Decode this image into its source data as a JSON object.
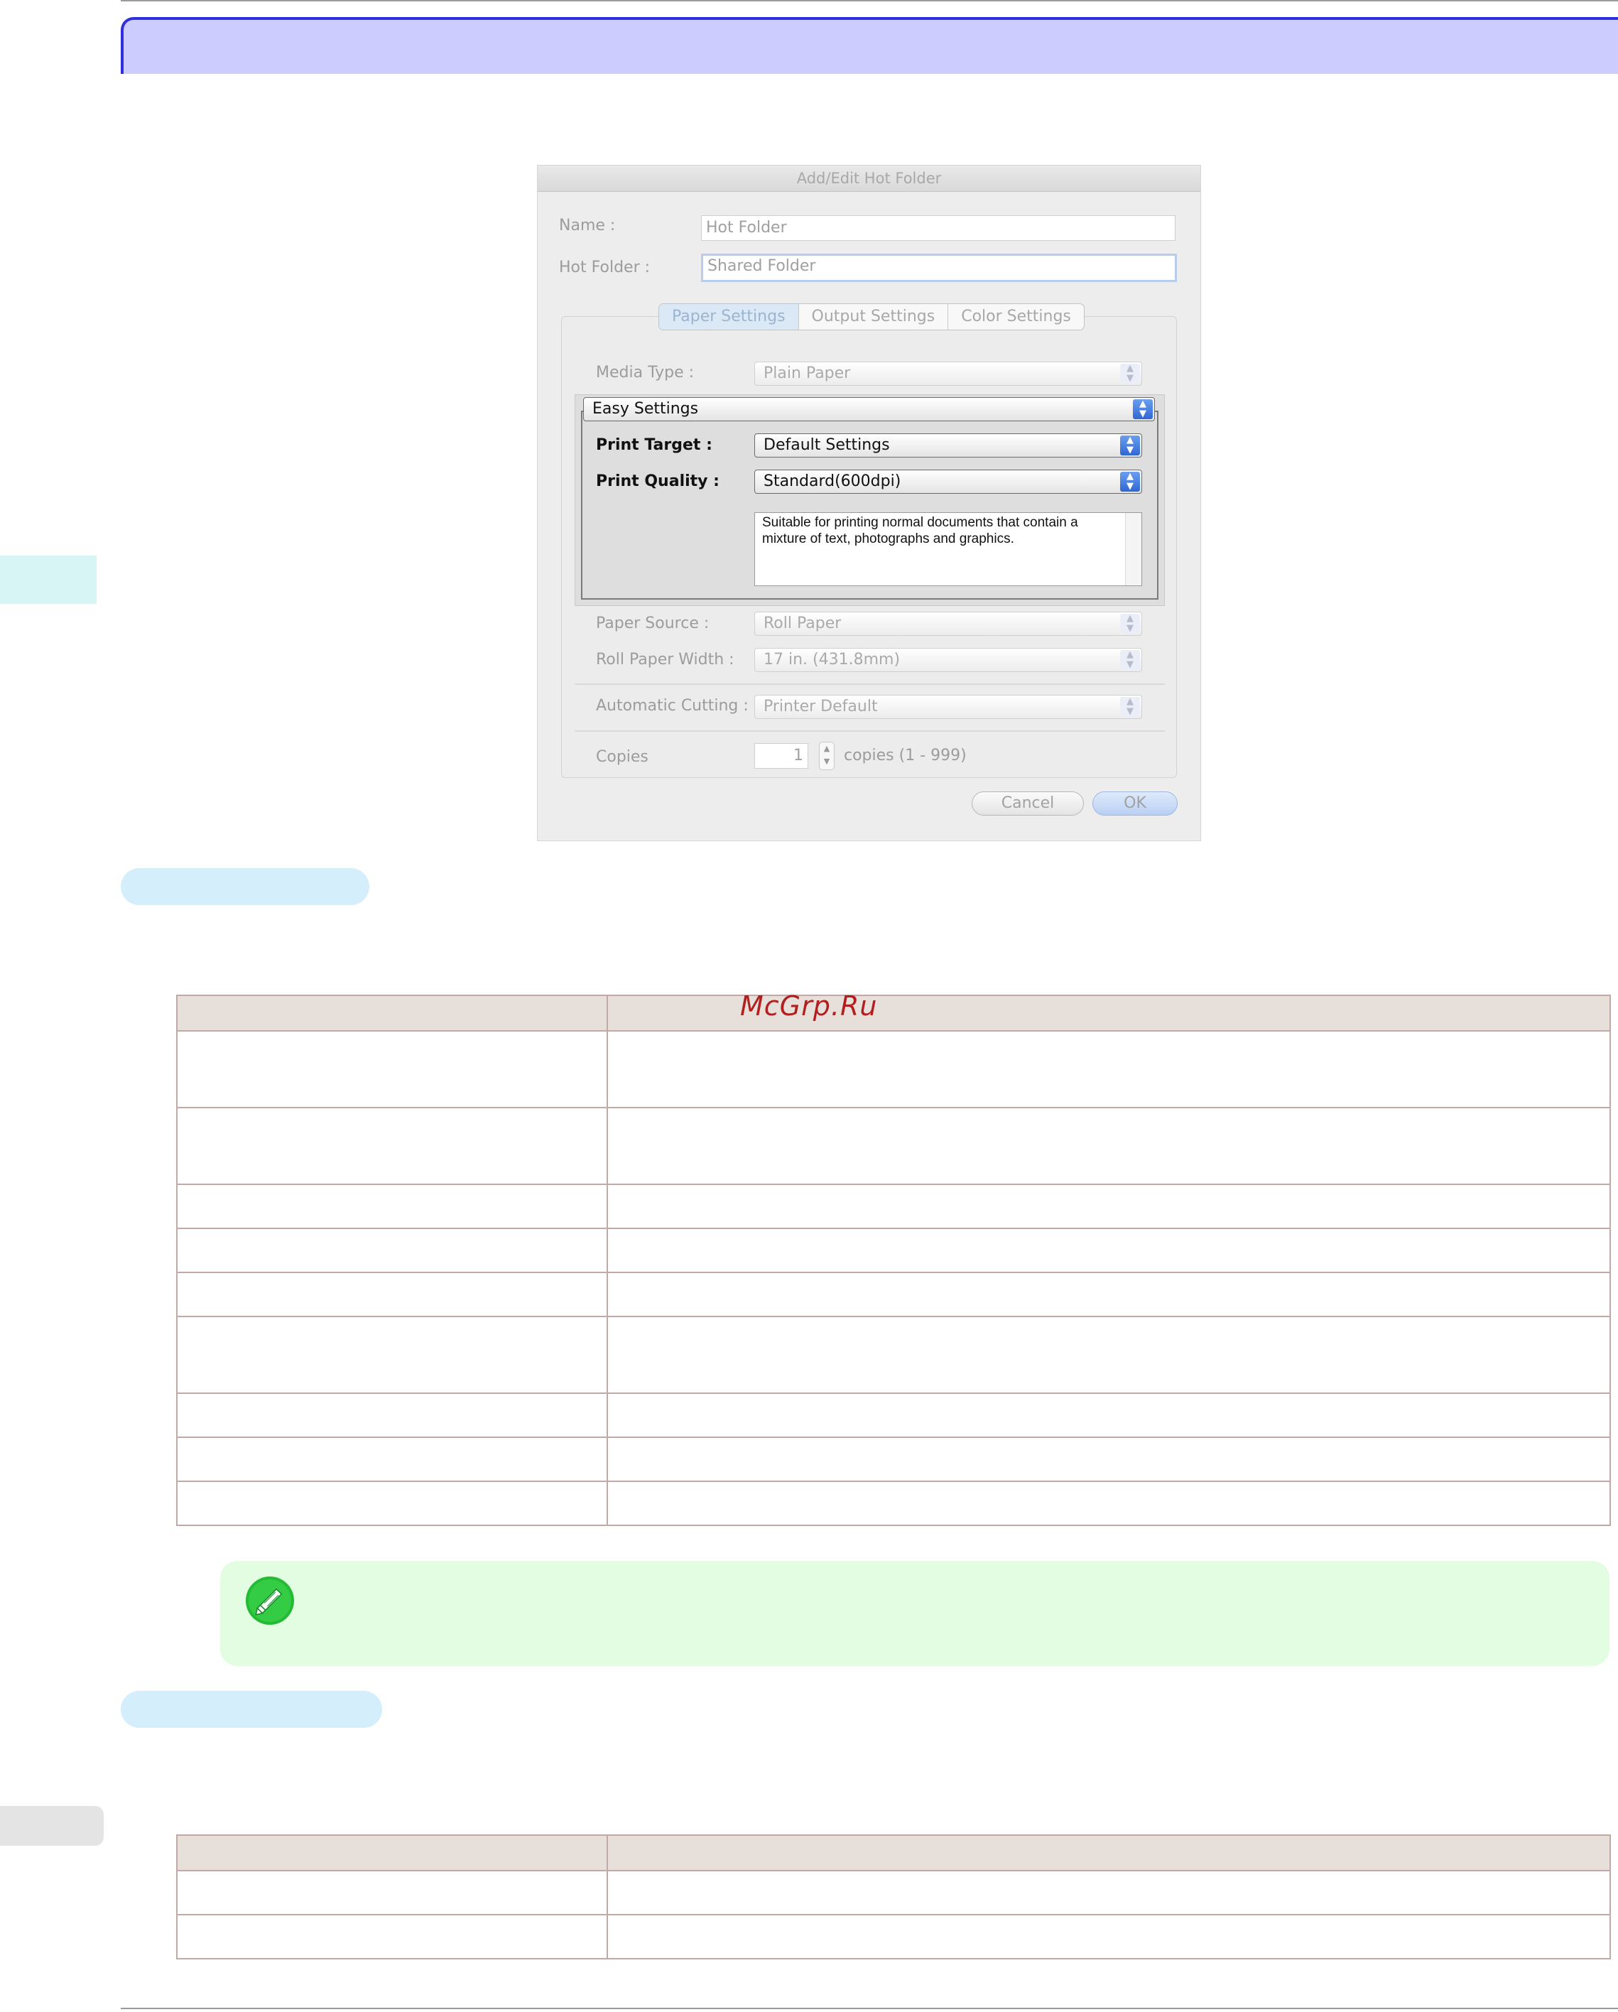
{
  "dialog": {
    "title": "Add/Edit Hot Folder",
    "name_label": "Name :",
    "name_value": "Hot Folder",
    "hot_folder_label": "Hot Folder :",
    "hot_folder_value": "Shared Folder",
    "tabs": [
      {
        "label": "Paper Settings",
        "active": true
      },
      {
        "label": "Output Settings",
        "active": false
      },
      {
        "label": "Color Settings",
        "active": false
      }
    ],
    "media_type_label": "Media Type :",
    "media_type_value": "Plain Paper",
    "easy_settings_value": "Easy Settings",
    "print_target_label": "Print Target :",
    "print_target_value": "Default Settings",
    "print_quality_label": "Print Quality :",
    "print_quality_value": "Standard(600dpi)",
    "description": "Suitable for printing normal documents that contain a mixture of text, photographs and graphics.",
    "paper_source_label": "Paper Source :",
    "paper_source_value": "Roll Paper",
    "roll_width_label": "Roll Paper Width :",
    "roll_width_value": "17 in. (431.8mm)",
    "auto_cut_label": "Automatic Cutting :",
    "auto_cut_value": "Printer Default",
    "copies_label": "Copies",
    "copies_value": "1",
    "copies_range": "copies (1 - 999)",
    "cancel_label": "Cancel",
    "ok_label": "OK"
  },
  "watermark": "McGrp.Ru",
  "colors": {
    "title_bar": "#ccccff",
    "title_border": "#2f2fe0",
    "pill": "#d4eefb",
    "note_bg": "#e2fde2",
    "table_border": "#c2a9a5",
    "table_header": "#e6dfda",
    "watermark": "#b21f1f"
  },
  "icons": {
    "note": "pencil-note-icon"
  }
}
